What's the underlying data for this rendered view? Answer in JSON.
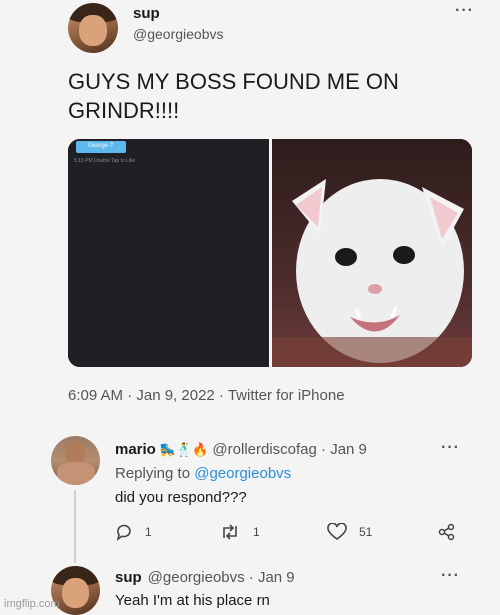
{
  "main_tweet": {
    "name": "sup",
    "handle": "@georgieobvs",
    "text_line1": "GUYS MY BOSS FOUND ME ON",
    "text_line2": "GRINDR!!!!",
    "media": {
      "left_panel": {
        "badge": "George ?",
        "subtext": "5:15 PM   Double Tap to Like"
      },
      "right_panel_icon": "kitten-photo"
    },
    "timestamp": "6:09 AM · Jan 9, 2022 · Twitter for iPhone"
  },
  "reply1": {
    "name": "mario",
    "emojis": "🛼🕺🔥",
    "handle_date": "@rollerdiscofag · Jan 9",
    "replying_prefix": "Replying to ",
    "replying_handle": "@georgieobvs",
    "text": "did you respond???",
    "actions": {
      "reply_count": "1",
      "retweet_count": "1",
      "like_count": "51"
    }
  },
  "reply2": {
    "name": "sup",
    "handle_date": "@georgieobvs · Jan 9",
    "text": "Yeah I'm at his place rn"
  },
  "watermark": "imgflip.com",
  "colors": {
    "link": "#2a8fd6",
    "badge": "#5fb8ee"
  }
}
